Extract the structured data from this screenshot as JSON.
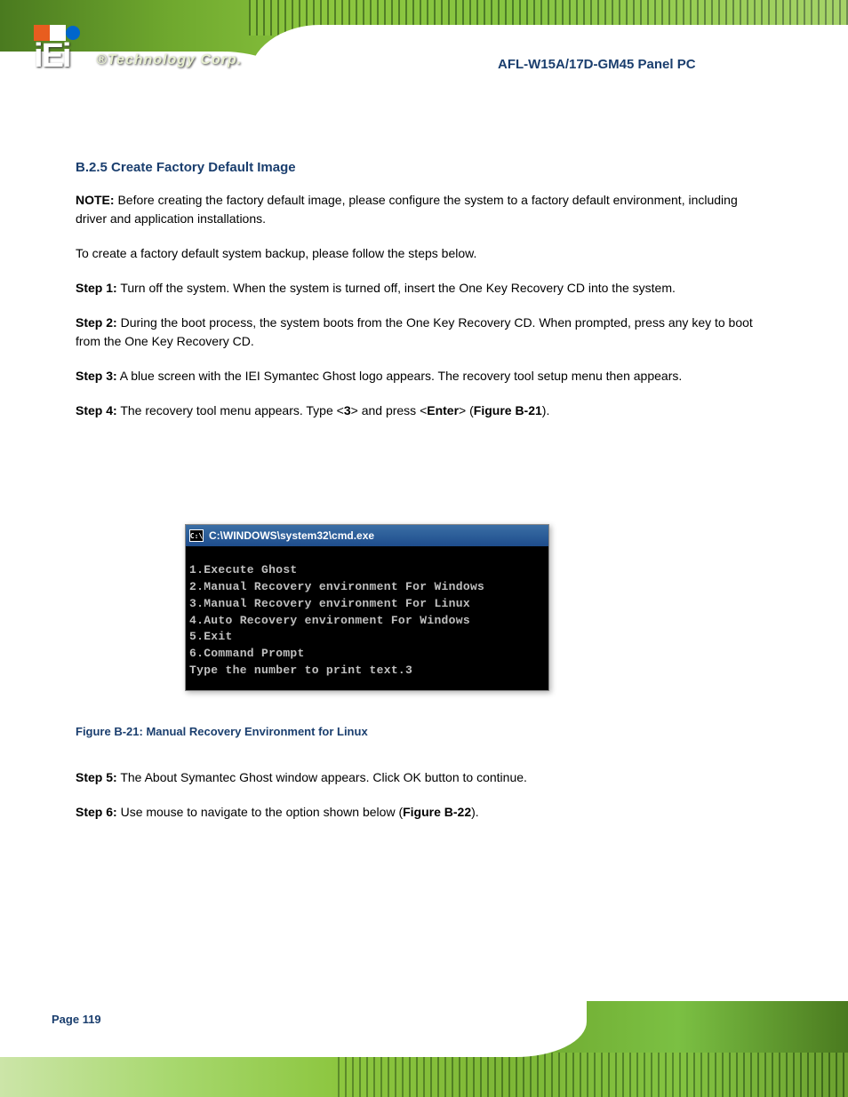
{
  "header": {
    "logo_main": "iEi",
    "tagline_reg": "®",
    "tagline": "Technology Corp.",
    "product": "AFL-W15A/17D-GM45 Panel PC"
  },
  "body": {
    "intro": "To create a factory default system backup, please follow the steps below.",
    "step1_label": "Step 1:",
    "step1_text": " Turn off the system. When the system is turned off, insert the One Key Recovery CD into the system.",
    "step2_label": "Step 2:",
    "step2_text": " During the boot process, the system boots from the One Key Recovery CD. When prompted, press any key to boot from the One Key Recovery CD.",
    "step3_label": "Step 3:",
    "step3_text": " A blue screen with the IEI Symantec Ghost logo appears. The recovery tool setup menu then appears.",
    "section_title": "B.2.5  Create Factory Default Image",
    "note_label": "NOTE:",
    "note_text": " Before creating the factory default image, please configure the system to a factory default environment, including driver and application installations.",
    "step4_label": "Step 4:",
    "step4_text_a": " The recovery tool menu appears. Type <",
    "step4_key": "3",
    "step4_text_b": "> and press <",
    "step4_enter": "Enter",
    "step4_text_c": "> (",
    "step4_figref": "Figure B-21",
    "step4_text_d": ").",
    "figure_caption": "Figure B-21: Manual Recovery Environment for Linux",
    "step5_label": "Step 5:",
    "step5_text": " The About Symantec Ghost window appears. Click OK button to continue.",
    "step6_label": "Step 6:",
    "step6_text_a": " Use mouse to navigate to the option shown below (",
    "step6_figref": "Figure B-22",
    "step6_text_b": ")."
  },
  "cmd": {
    "title": "C:\\WINDOWS\\system32\\cmd.exe",
    "icon_text": "C:\\",
    "lines": [
      "1.Execute Ghost",
      "2.Manual Recovery environment For Windows",
      "3.Manual Recovery environment For Linux",
      "4.Auto Recovery environment For Windows",
      "5.Exit",
      "6.Command Prompt",
      "Type the number to print text.3"
    ]
  },
  "footer": {
    "page_label": "Page ",
    "page_num": "119"
  }
}
